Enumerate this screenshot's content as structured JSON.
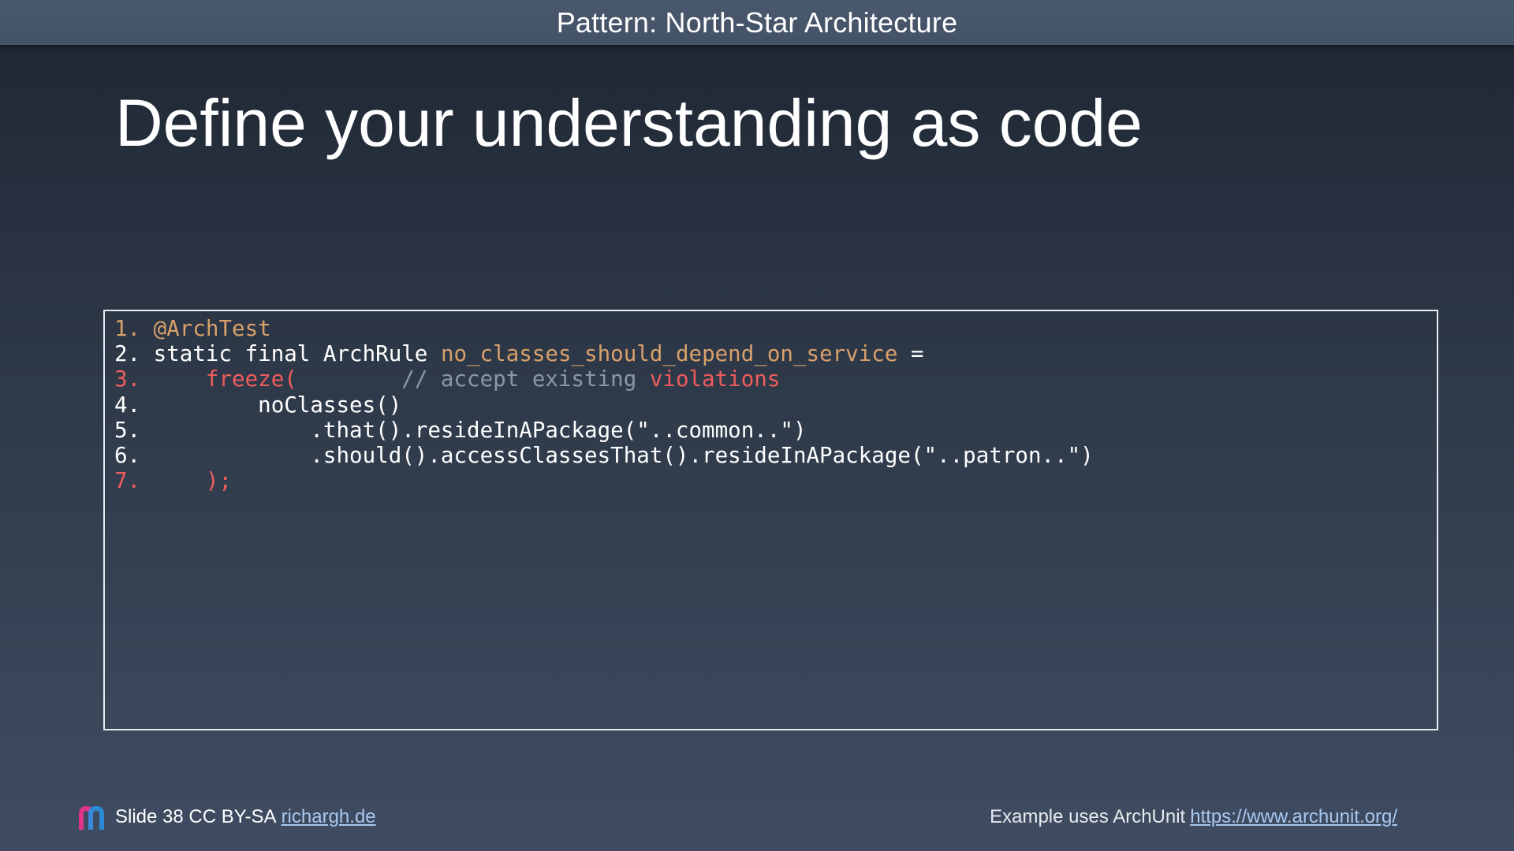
{
  "header": {
    "title": "Pattern: North-Star Architecture"
  },
  "slide": {
    "title": "Define your understanding as code"
  },
  "code": {
    "lines": [
      {
        "num": "1.",
        "segments": [
          {
            "text": " @ArchTest",
            "color": "orange"
          }
        ],
        "num_color": "orange"
      },
      {
        "num": "2.",
        "segments": [
          {
            "text": " static final ArchRule ",
            "color": "white"
          },
          {
            "text": "no_classes_should_depend_on_service",
            "color": "orange"
          },
          {
            "text": " =",
            "color": "white"
          }
        ],
        "num_color": "white"
      },
      {
        "num": "3.",
        "segments": [
          {
            "text": "     freeze(",
            "color": "red"
          },
          {
            "text": "        // accept existing ",
            "color": "gray"
          },
          {
            "text": "violations",
            "color": "red"
          }
        ],
        "num_color": "red"
      },
      {
        "num": "4.",
        "segments": [
          {
            "text": "         noClasses()",
            "color": "white"
          }
        ],
        "num_color": "white"
      },
      {
        "num": "5.",
        "segments": [
          {
            "text": "             .that().resideInAPackage(\"..common..\")",
            "color": "white"
          }
        ],
        "num_color": "white"
      },
      {
        "num": "6.",
        "segments": [
          {
            "text": "             .should().accessClassesThat().resideInAPackage(\"..patron..\")",
            "color": "white"
          }
        ],
        "num_color": "white"
      },
      {
        "num": "7.",
        "segments": [
          {
            "text": "     );",
            "color": "red"
          }
        ],
        "num_color": "red"
      }
    ]
  },
  "footer": {
    "slide_text": "Slide 38 CC BY-SA",
    "author_link": "richargh.de",
    "example_text": "Example uses ArchUnit",
    "archunit_link": "https://www.archunit.org/"
  },
  "colors": {
    "red": "#ef5c5c",
    "orange": "#d9a06b",
    "gray": "#8b97a8",
    "white": "#ffffff",
    "link": "#a9c8f0",
    "logo_pink": "#e0348a",
    "logo_blue": "#2a8fe0"
  },
  "icons": {
    "logo": "richargh-logo-icon"
  }
}
